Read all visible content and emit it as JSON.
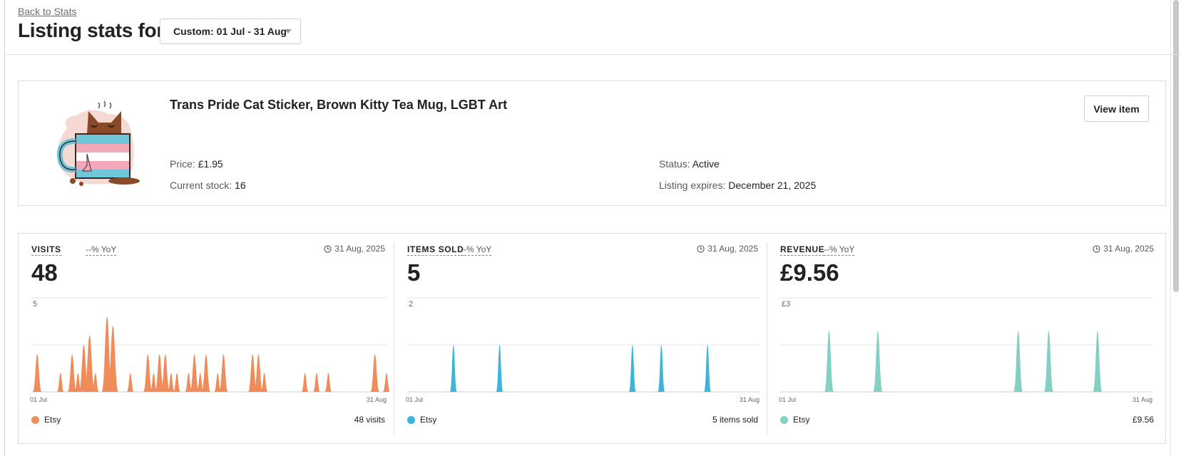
{
  "header": {
    "back_link": "Back to Stats",
    "title": "Listing stats for",
    "date_range": "Custom: 01 Jul - 31 Aug"
  },
  "listing": {
    "title": "Trans Pride Cat Sticker, Brown Kitty Tea Mug, LGBT Art",
    "price_label": "Price:",
    "price_value": "£1.95",
    "stock_label": "Current stock:",
    "stock_value": "16",
    "status_label": "Status:",
    "status_value": "Active",
    "expires_label": "Listing expires:",
    "expires_value": "December 21, 2025",
    "view_button": "View item",
    "image_icon": "cat-mug-sticker"
  },
  "colors": {
    "visits": "#f08c5a",
    "items_sold": "#3cb4dc",
    "revenue": "#84d0c4"
  },
  "stats": [
    {
      "label": "VISITS",
      "yoy": "--% YoY",
      "date": "31 Aug, 2025",
      "value": "48",
      "legend": "Etsy",
      "total": "48 visits"
    },
    {
      "label": "ITEMS SOLD",
      "yoy": "--% YoY",
      "date": "31 Aug, 2025",
      "value": "5",
      "legend": "Etsy",
      "total": "5 items sold"
    },
    {
      "label": "REVENUE",
      "yoy": "--% YoY",
      "date": "31 Aug, 2025",
      "value": "£9.56",
      "legend": "Etsy",
      "total": "£9.56"
    }
  ],
  "chart_data": [
    {
      "type": "area",
      "series": [
        {
          "name": "Etsy",
          "color": "#f08c5a",
          "x": [
            1,
            2,
            3,
            4,
            5,
            6,
            7,
            8,
            9,
            10,
            11,
            12,
            13,
            14,
            15,
            16,
            17,
            18,
            19,
            20,
            21,
            22,
            23,
            24,
            25,
            26,
            27,
            28,
            29,
            30,
            31,
            32,
            33,
            34,
            35,
            36,
            37,
            38,
            39,
            40,
            41,
            42,
            43,
            44,
            45,
            46,
            47,
            48,
            49,
            50,
            51,
            52,
            53,
            54,
            55,
            56,
            57,
            58,
            59,
            60,
            61,
            62
          ],
          "values": [
            0,
            2,
            0,
            0,
            0,
            1,
            0,
            2,
            1,
            2.5,
            3,
            1,
            0,
            4,
            3.5,
            0,
            0,
            1,
            0,
            0,
            2,
            1,
            2,
            2,
            1,
            1,
            0,
            1,
            2,
            1,
            2,
            0,
            1,
            2,
            0,
            0,
            0,
            0,
            2,
            2,
            1,
            0,
            0,
            0,
            0,
            0,
            0,
            1,
            0,
            1,
            0,
            1,
            0,
            0,
            0,
            0,
            0,
            0,
            0,
            2,
            0,
            1
          ]
        }
      ],
      "xtick_labels": [
        "01 Jul",
        "31 Aug"
      ],
      "ytick_labels": [
        "5"
      ],
      "ylim": [
        0,
        5
      ],
      "grid": true
    },
    {
      "type": "area",
      "series": [
        {
          "name": "Etsy",
          "color": "#3cb4dc",
          "x": [
            9,
            17,
            40,
            45,
            53
          ],
          "values": [
            1,
            1,
            1,
            1,
            1
          ]
        }
      ],
      "xtick_labels": [
        "01 Jul",
        "31 Aug"
      ],
      "ytick_labels": [
        "2"
      ],
      "ylim": [
        0,
        2
      ],
      "grid": true
    },
    {
      "type": "area",
      "series": [
        {
          "name": "Etsy",
          "color": "#84d0c4",
          "x": [
            9,
            17,
            40,
            45,
            53
          ],
          "values": [
            1.95,
            1.95,
            1.95,
            1.95,
            1.95
          ]
        }
      ],
      "xtick_labels": [
        "01 Jul",
        "31 Aug"
      ],
      "ytick_labels": [
        "£3"
      ],
      "ylim": [
        0,
        3
      ],
      "grid": true
    }
  ]
}
